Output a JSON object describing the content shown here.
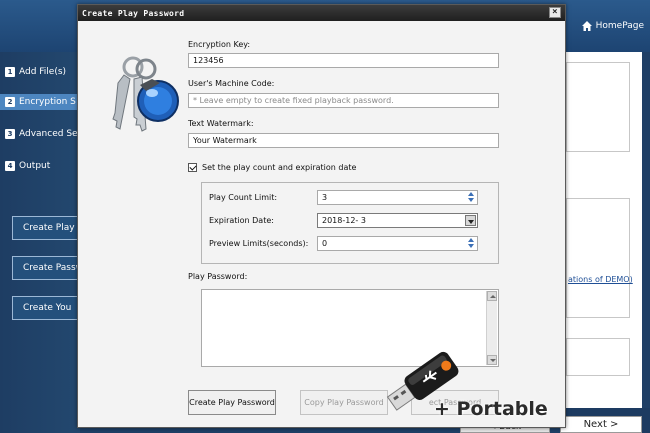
{
  "app": {
    "homepage_label": "HomePage",
    "sidebar": [
      {
        "num": "1",
        "label": "Add File(s)"
      },
      {
        "num": "2",
        "label": "Encryption S"
      },
      {
        "num": "3",
        "label": "Advanced Se"
      },
      {
        "num": "4",
        "label": "Output"
      }
    ],
    "side_buttons": [
      "Create Play P",
      "Create Passw",
      "Create You"
    ],
    "demo_link": "ations of DEMO)",
    "back_label": "< Back",
    "next_label": "Next >"
  },
  "dialog": {
    "title": "Create Play Password",
    "close_label": "×",
    "encryption_key": {
      "label": "Encryption Key:",
      "value": "123456"
    },
    "machine_code": {
      "label": "User's Machine Code:",
      "placeholder": "* Leave empty to create fixed playback password."
    },
    "text_watermark": {
      "label": "Text Watermark:",
      "value": "Your Watermark"
    },
    "play_count_checkbox": {
      "label": "Set the play count and expiration date",
      "checked": true
    },
    "play_count_limit": {
      "label": "Play Count Limit:",
      "value": "3"
    },
    "expiration_date": {
      "label": "Expiration Date:",
      "value": "2018-12-  3"
    },
    "preview_limits": {
      "label": "Preview Limits(seconds):",
      "value": "0"
    },
    "play_password": {
      "label": "Play Password:",
      "value": ""
    },
    "buttons": {
      "create": "Create Play Password",
      "copy": "Copy Play Password",
      "other": "ect Password"
    }
  },
  "overlay": {
    "portable_label": "+ Portable"
  },
  "colors": {
    "dialog_title_bg": "#2a2a2a",
    "active_nav": "#4d86c0",
    "sidebar_bg": "#1e3d63",
    "link": "#1f4f96"
  },
  "icons": [
    "home-icon",
    "keys-icon",
    "usb-drive-icon",
    "close-icon",
    "spin-up-icon",
    "spin-down-icon",
    "dropdown-arrow-icon"
  ]
}
